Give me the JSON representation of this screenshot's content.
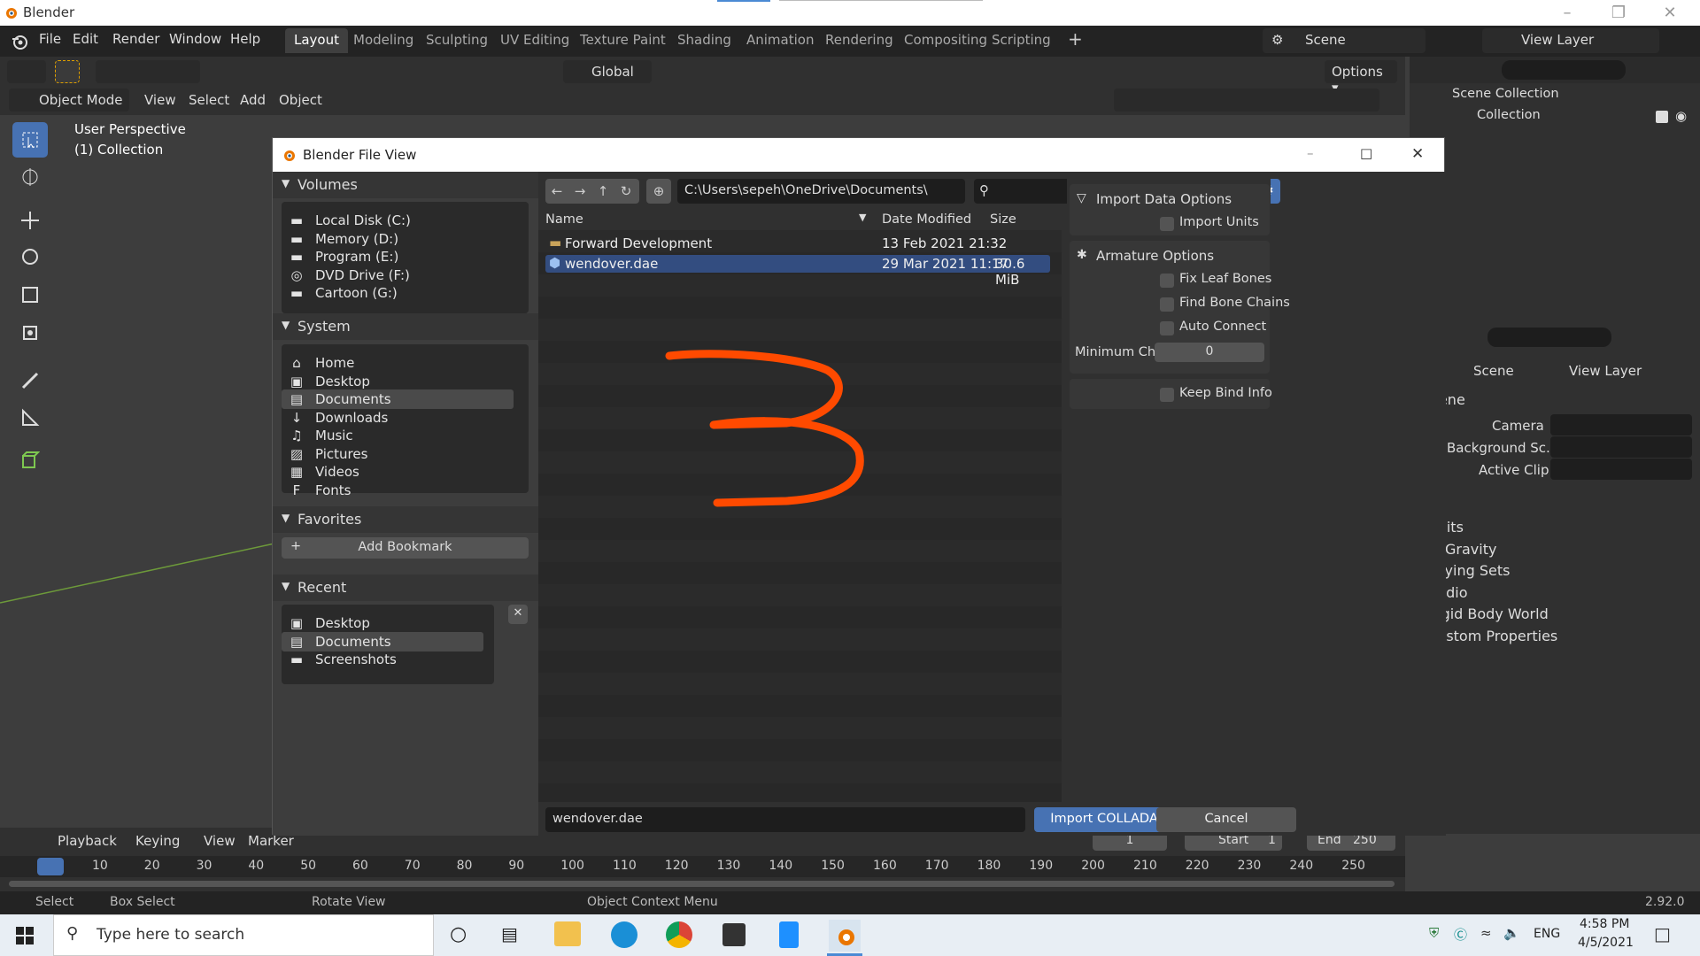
{
  "window": {
    "title": "Blender"
  },
  "menubar": {
    "items": [
      "File",
      "Edit",
      "Render",
      "Window",
      "Help"
    ]
  },
  "workspaces": [
    "Layout",
    "Modeling",
    "Sculpting",
    "UV Editing",
    "Texture Paint",
    "Shading",
    "Animation",
    "Rendering",
    "Compositing",
    "Scripting"
  ],
  "scene_selector": {
    "scene": "Scene",
    "view_layer": "View Layer"
  },
  "viewport": {
    "mode": "Object Mode",
    "menus": [
      "View",
      "Select",
      "Add",
      "Object"
    ],
    "transform_orientation": "Global",
    "options_label": "Options",
    "overlay_line1": "User Perspective",
    "overlay_line2": "(1) Collection"
  },
  "outliner": {
    "scene_collection": "Scene Collection",
    "collection": "Collection"
  },
  "properties": {
    "tab_scene": "Scene",
    "tab_view_layer": "View Layer",
    "section": "Scene",
    "rows": [
      {
        "label": "Camera"
      },
      {
        "label": "Background Sc..."
      },
      {
        "label": "Active Clip"
      }
    ],
    "subpanels": [
      "Units",
      "Gravity",
      "Keying Sets",
      "Audio",
      "Rigid Body World",
      "Custom Properties"
    ],
    "gravity_checked": true
  },
  "timeline": {
    "menus": [
      "Playback",
      "Keying",
      "View",
      "Marker"
    ],
    "current_frame": "1",
    "start_label": "Start",
    "start": "1",
    "end_label": "End",
    "end": "250",
    "ruler": [
      "1",
      "10",
      "20",
      "30",
      "40",
      "50",
      "60",
      "70",
      "80",
      "90",
      "100",
      "110",
      "120",
      "130",
      "140",
      "150",
      "160",
      "170",
      "180",
      "190",
      "200",
      "210",
      "220",
      "230",
      "240",
      "250"
    ]
  },
  "statusbar": {
    "select": "Select",
    "box_select": "Box Select",
    "rotate_view": "Rotate View",
    "context_menu": "Object Context Menu",
    "version": "2.92.0"
  },
  "dialog": {
    "title": "Blender File View",
    "path": "C:\\Users\\sepeh\\OneDrive\\Documents\\",
    "volumes_label": "Volumes",
    "volumes": [
      {
        "name": "Local Disk (C:)",
        "icon": "disk-icon"
      },
      {
        "name": "Memory (D:)",
        "icon": "disk-icon"
      },
      {
        "name": "Program (E:)",
        "icon": "disk-icon"
      },
      {
        "name": "DVD Drive (F:)",
        "icon": "dvd-icon"
      },
      {
        "name": "Cartoon (G:)",
        "icon": "disk-icon"
      }
    ],
    "system_label": "System",
    "system": [
      {
        "name": "Home",
        "icon": "home-icon"
      },
      {
        "name": "Desktop",
        "icon": "desktop-icon"
      },
      {
        "name": "Documents",
        "icon": "documents-icon",
        "selected": true
      },
      {
        "name": "Downloads",
        "icon": "download-icon"
      },
      {
        "name": "Music",
        "icon": "music-icon"
      },
      {
        "name": "Pictures",
        "icon": "pictures-icon"
      },
      {
        "name": "Videos",
        "icon": "videos-icon"
      },
      {
        "name": "Fonts",
        "icon": "font-icon"
      }
    ],
    "favorites_label": "Favorites",
    "add_bookmark": "Add Bookmark",
    "recent_label": "Recent",
    "recent": [
      {
        "name": "Desktop",
        "icon": "desktop-icon"
      },
      {
        "name": "Documents",
        "icon": "documents-icon",
        "selected": true
      },
      {
        "name": "Screenshots",
        "icon": "folder-icon"
      }
    ],
    "columns": {
      "name": "Name",
      "date": "Date Modified",
      "size": "Size"
    },
    "files": [
      {
        "name": "Forward Development",
        "date": "13 Feb 2021 21:32",
        "size": "",
        "icon": "folder-icon",
        "selected": false
      },
      {
        "name": "wendover.dae",
        "date": "29 Mar 2021 11:17",
        "size": "30.6 MiB",
        "icon": "mesh-icon",
        "selected": true
      }
    ],
    "annotation": "3",
    "annotation_color": "#ff4a00",
    "import_data_options": "Import Data Options",
    "import_units": "Import Units",
    "armature_options": "Armature Options",
    "fix_leaf_bones": "Fix Leaf Bones",
    "find_bone_chains": "Find Bone Chains",
    "auto_connect": "Auto Connect",
    "min_chain_label": "Minimum Chai...",
    "min_chain_value": "0",
    "keep_bind_info": "Keep Bind Info",
    "filename": "wendover.dae",
    "import_button": "Import COLLADA",
    "cancel_button": "Cancel"
  },
  "taskbar": {
    "search_placeholder": "Type here to search",
    "language": "ENG",
    "time": "4:58 PM",
    "date": "4/5/2021"
  },
  "colors": {
    "accent": "#4772b3",
    "selection": "#334d80",
    "ui_dark": "#303030"
  }
}
